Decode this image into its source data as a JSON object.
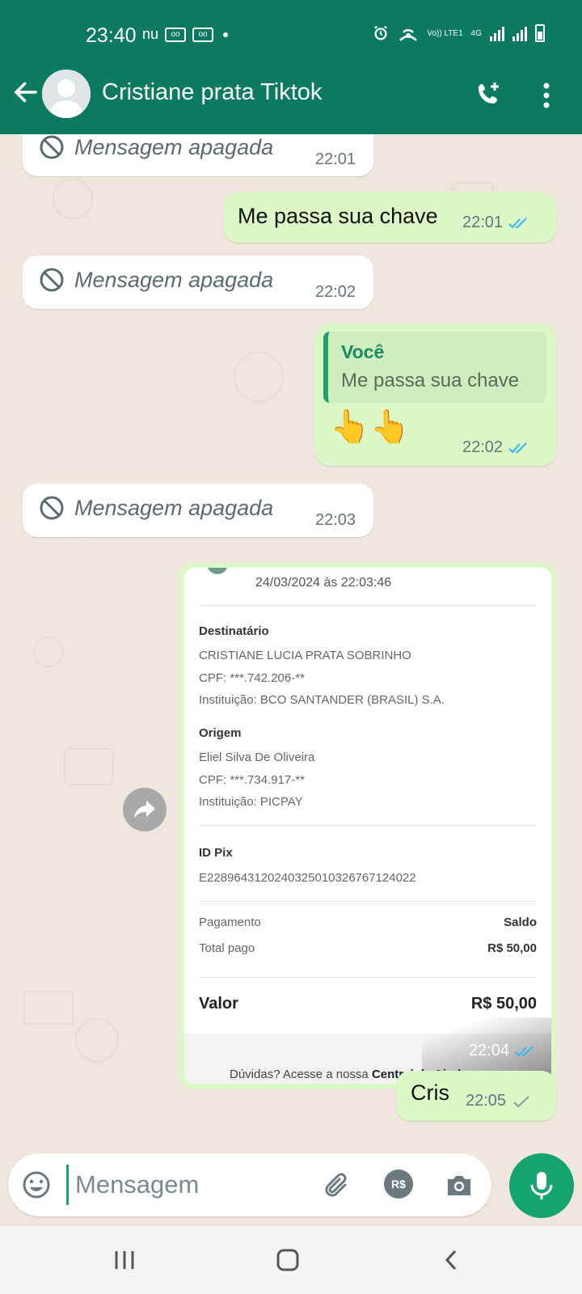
{
  "status_bar": {
    "time": "23:40",
    "network_left": "nu",
    "network_right": "4G",
    "volte": "Vo)) LTE1"
  },
  "header": {
    "contact_name": "Cristiane prata Tiktok",
    "icons": [
      "back-arrow-icon",
      "avatar",
      "add-call-icon",
      "more-vert-icon"
    ]
  },
  "messages": [
    {
      "type": "deleted",
      "direction": "in",
      "text": "Mensagem apagada",
      "time": "22:01"
    },
    {
      "type": "text",
      "direction": "out",
      "text": "Me passa sua chave",
      "time": "22:01",
      "status": "read"
    },
    {
      "type": "deleted",
      "direction": "in",
      "text": "Mensagem apagada",
      "time": "22:02"
    },
    {
      "type": "reply",
      "direction": "out",
      "quoted_author": "Você",
      "quoted_text": "Me passa sua chave",
      "text": "👆👆",
      "time": "22:02",
      "status": "read"
    },
    {
      "type": "deleted",
      "direction": "in",
      "text": "Mensagem apagada",
      "time": "22:03"
    },
    {
      "type": "image",
      "direction": "out",
      "time": "22:04",
      "status": "read"
    },
    {
      "type": "text",
      "direction": "out",
      "text": "Cris",
      "time": "22:05",
      "status": "sent"
    }
  ],
  "receipt": {
    "date": "24/03/2024 às 22:03:46",
    "destinatario_label": "Destinatário",
    "destinatario_name": "CRISTIANE LUCIA PRATA SOBRINHO",
    "destinatario_cpf": "CPF: ***.742.206-**",
    "destinatario_inst": "Instituição: BCO SANTANDER (BRASIL) S.A.",
    "origem_label": "Origem",
    "origem_name": "Eliel Silva De Oliveira",
    "origem_cpf": "CPF: ***.734.917-**",
    "origem_inst": "Instituição: PICPAY",
    "idpix_label": "ID Pix",
    "idpix_value": "E22896431202403250103267671240​22",
    "pagamento_label": "Pagamento",
    "pagamento_value": "Saldo",
    "total_label": "Total pago",
    "total_value": "R$ 50,00",
    "valor_label": "Valor",
    "valor_value": "R$ 50,00",
    "footer_text": "Dúvidas? Acesse a nossa",
    "footer_link": "Central de Ajuda"
  },
  "input_bar": {
    "placeholder": "Mensagem",
    "pay_label": "R$"
  },
  "colors": {
    "header": "#0b7a5f",
    "outgoing_bubble": "#dcf8c6",
    "incoming_bubble": "#ffffff",
    "chat_bg": "#efe7dd",
    "tick_read": "#34b7f1",
    "mic_button": "#15a36f"
  }
}
